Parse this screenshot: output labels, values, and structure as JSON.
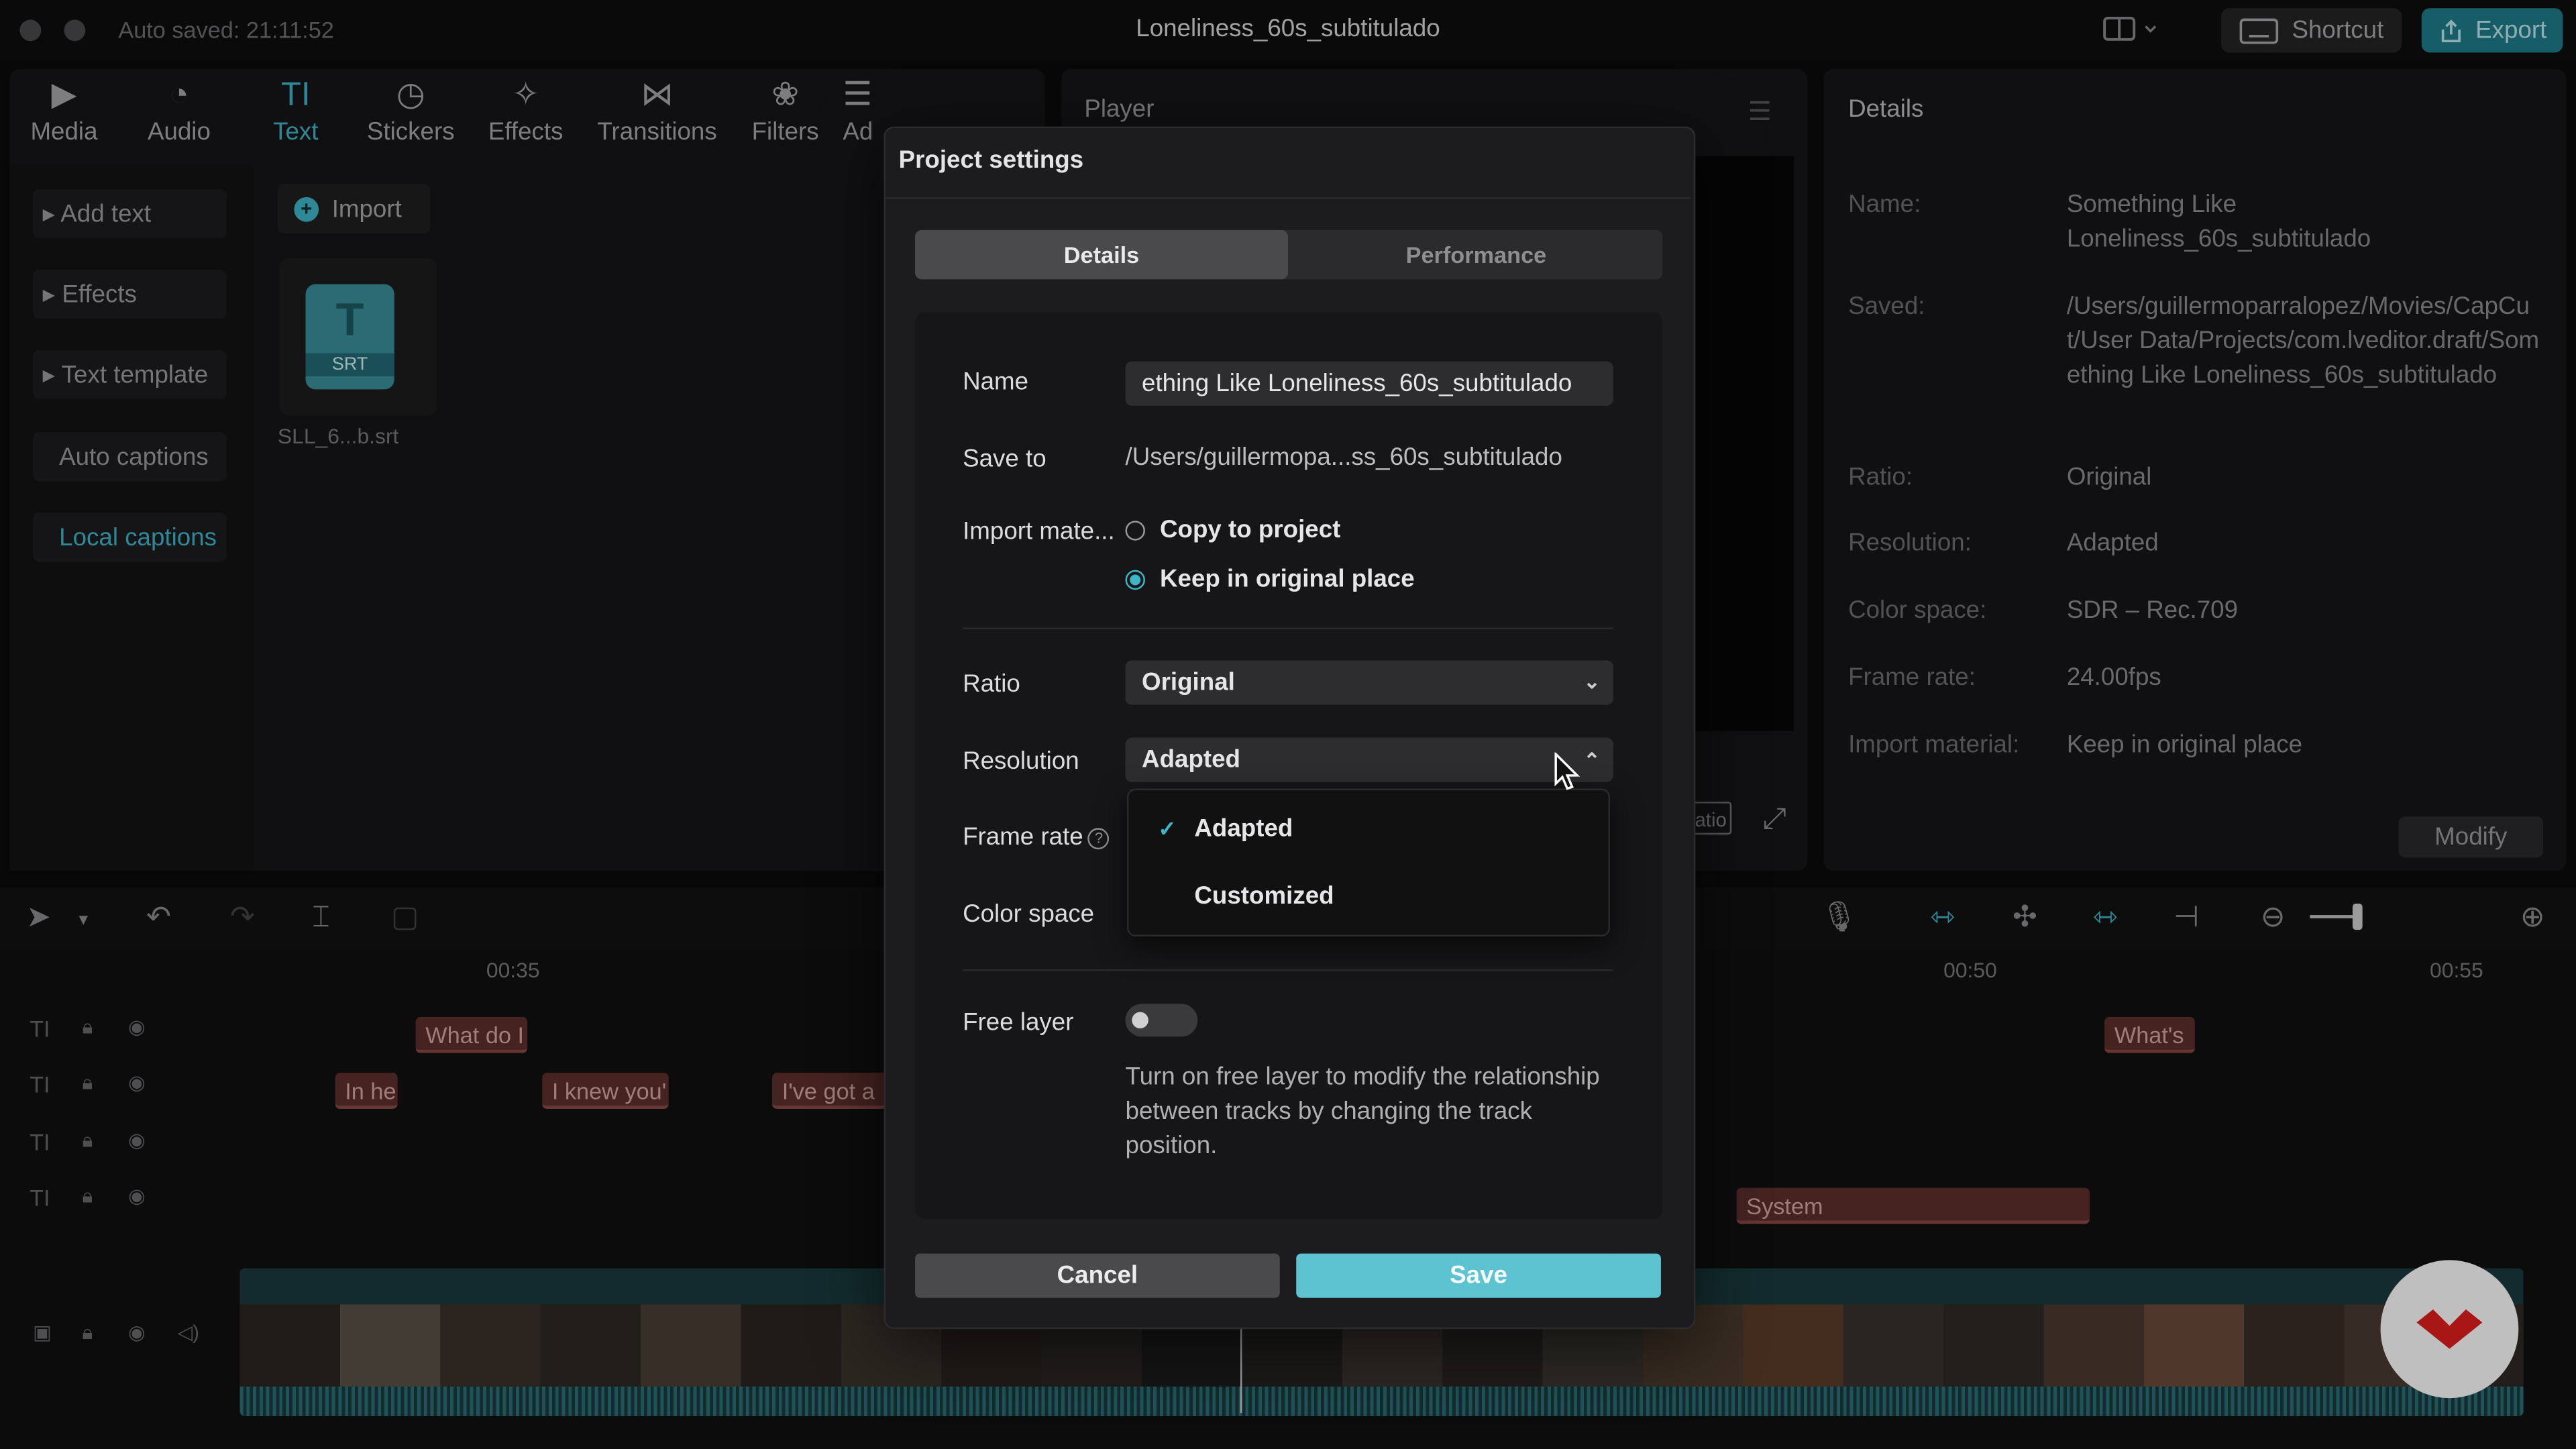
{
  "titlebar": {
    "autosaved": "Auto saved: 21:11:52",
    "doc_title": "Loneliness_60s_subtitulado",
    "shortcut_label": "Shortcut",
    "export_label": "Export"
  },
  "toolbar": {
    "items": [
      {
        "label": "Media",
        "icon": "media-icon"
      },
      {
        "label": "Audio",
        "icon": "audio-icon"
      },
      {
        "label": "Text",
        "icon": "text-icon",
        "active": true
      },
      {
        "label": "Stickers",
        "icon": "stickers-icon"
      },
      {
        "label": "Effects",
        "icon": "effects-icon"
      },
      {
        "label": "Transitions",
        "icon": "transitions-icon"
      },
      {
        "label": "Filters",
        "icon": "filters-icon"
      },
      {
        "label": "Ad",
        "icon": "adjust-icon"
      }
    ]
  },
  "sidenav": {
    "items": [
      {
        "label": "▸ Add text"
      },
      {
        "label": "▸ Effects"
      },
      {
        "label": "▸ Text template"
      },
      {
        "label": "Auto captions"
      },
      {
        "label": "Local captions",
        "active": true
      }
    ]
  },
  "media": {
    "import_label": "Import",
    "file_badge": "SRT",
    "file_name": "SLL_6...b.srt"
  },
  "player": {
    "title": "Player",
    "ratio_label": "atio"
  },
  "details": {
    "title": "Details",
    "rows": [
      {
        "label": "Name:",
        "value": "Something Like Loneliness_60s_subtitulado"
      },
      {
        "label": "Saved:",
        "value": "/Users/guillermoparralopez/Movies/CapCut/User Data/Projects/com.lveditor.draft/Something Like Loneliness_60s_subtitulado"
      },
      {
        "label": "Ratio:",
        "value": "Original"
      },
      {
        "label": "Resolution:",
        "value": "Adapted"
      },
      {
        "label": "Color space:",
        "value": "SDR – Rec.709"
      },
      {
        "label": "Frame rate:",
        "value": "24.00fps"
      },
      {
        "label": "Import material:",
        "value": "Keep in original place"
      }
    ],
    "modify_label": "Modify"
  },
  "timeline": {
    "ruler": [
      "00:35",
      "00:50",
      "00:55"
    ],
    "clips": [
      {
        "text": "What do I"
      },
      {
        "text": "In he"
      },
      {
        "text": "I knew you'"
      },
      {
        "text": "I've got a"
      },
      {
        "text": "What's"
      },
      {
        "text": "System"
      }
    ]
  },
  "modal": {
    "title": "Project settings",
    "tabs": [
      "Details",
      "Performance"
    ],
    "name_label": "Name",
    "name_value": "ething Like Loneliness_60s_subtitulado",
    "saveto_label": "Save to",
    "saveto_value": "/Users/guillermopa...ss_60s_subtitulado",
    "import_label": "Import mate...",
    "import_options": [
      "Copy to project",
      "Keep in original place"
    ],
    "import_selected": "Keep in original place",
    "ratio_label": "Ratio",
    "ratio_value": "Original",
    "resolution_label": "Resolution",
    "resolution_value": "Adapted",
    "resolution_options": [
      "Adapted",
      "Customized"
    ],
    "framerate_label": "Frame rate",
    "colorspace_label": "Color space",
    "freelayer_label": "Free layer",
    "freelayer_on": false,
    "freelayer_desc": "Turn on free layer to modify the relationship between tracks by changing the track position.",
    "cancel_label": "Cancel",
    "save_label": "Save"
  },
  "colors": {
    "accent": "#3fb6c7",
    "save_button": "#5ec3d1",
    "clip": "#5b2f2c"
  }
}
